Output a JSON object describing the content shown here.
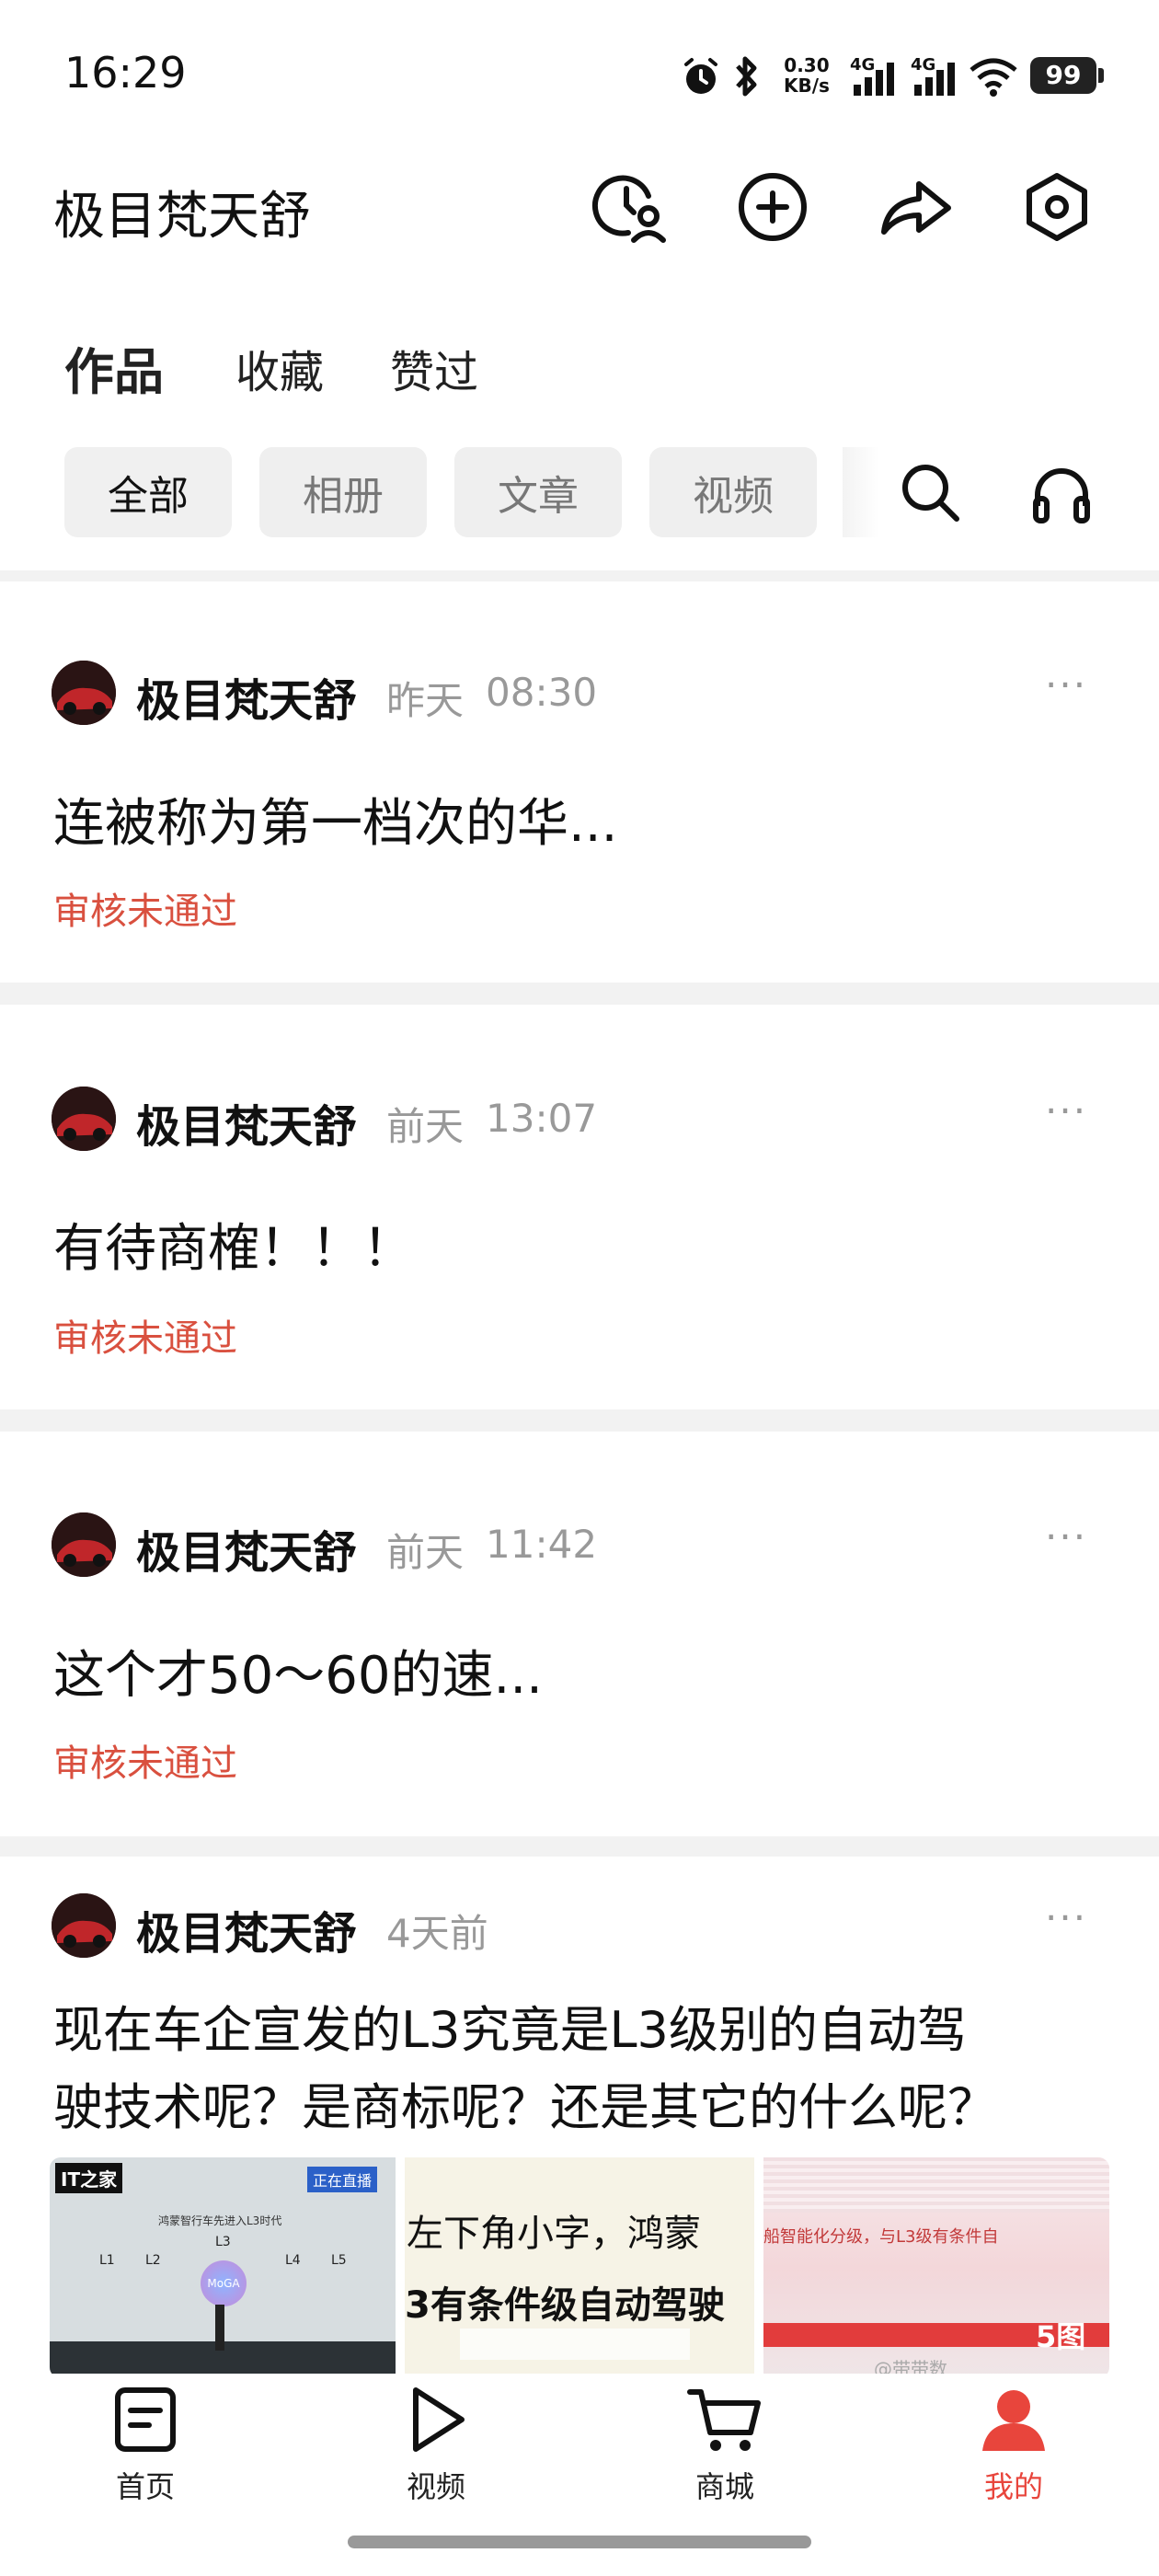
{
  "status_bar": {
    "time": "16:29",
    "net_speed_value": "0.30",
    "net_speed_unit": "KB/s",
    "signal1": "4G",
    "signal2": "4G",
    "battery": "99",
    "icons": [
      "alarm-icon",
      "bluetooth-icon",
      "signal-icon",
      "signal-icon",
      "wifi-icon",
      "battery-icon"
    ]
  },
  "header": {
    "username": "极目梵天舒",
    "icons": [
      "visitor-clock-icon",
      "add-icon",
      "share-icon",
      "settings-icon"
    ]
  },
  "tabs": [
    {
      "label": "作品",
      "active": true
    },
    {
      "label": "收藏",
      "active": false
    },
    {
      "label": "赞过",
      "active": false
    }
  ],
  "filters": [
    {
      "label": "全部",
      "active": true
    },
    {
      "label": "相册",
      "active": false
    },
    {
      "label": "文章",
      "active": false
    },
    {
      "label": "视频",
      "active": false
    }
  ],
  "filter_icons": [
    "search-icon",
    "headphones-icon"
  ],
  "posts": [
    {
      "author": "极目梵天舒",
      "day": "昨天",
      "time": "08:30",
      "text": "连被称为第一档次的华...",
      "status": "审核未通过"
    },
    {
      "author": "极目梵天舒",
      "day": "前天",
      "time": "13:07",
      "text": "有待商榷！！！",
      "status": "审核未通过"
    },
    {
      "author": "极目梵天舒",
      "day": "前天",
      "time": "11:42",
      "text": "这个才50～60的速...",
      "status": "审核未通过"
    },
    {
      "author": "极目梵天舒",
      "day": "4天前",
      "time": "",
      "text_line1": "现在车企宣发的L3究竟是L3级别的自动驾",
      "text_line2": "驶技术呢？是商标呢？还是其它的什么呢？",
      "thumbs": [
        {
          "top_text": "鸿蒙智行车先进入L3时代",
          "levels": [
            "L1",
            "L2",
            "L3",
            "L4",
            "L5"
          ],
          "center": "MoGA",
          "brand": "IT之家",
          "live": "正在直播"
        },
        {
          "line1": "左下角小字，鸿蒙",
          "line2": "3有条件级自动驾驶"
        },
        {
          "line": "船智能化分级，与L3级有条件自",
          "count": "5图",
          "watermark": "@带带数"
        }
      ]
    }
  ],
  "more_label": "···",
  "bottom_nav": [
    {
      "label": "首页",
      "icon": "home-doc-icon",
      "active": false
    },
    {
      "label": "视频",
      "icon": "play-icon",
      "active": false
    },
    {
      "label": "商城",
      "icon": "cart-icon",
      "active": false
    },
    {
      "label": "我的",
      "icon": "user-icon",
      "active": true
    }
  ],
  "colors": {
    "accent_red": "#e8453c",
    "status_red": "#d9503f",
    "text_gray": "#999999"
  }
}
